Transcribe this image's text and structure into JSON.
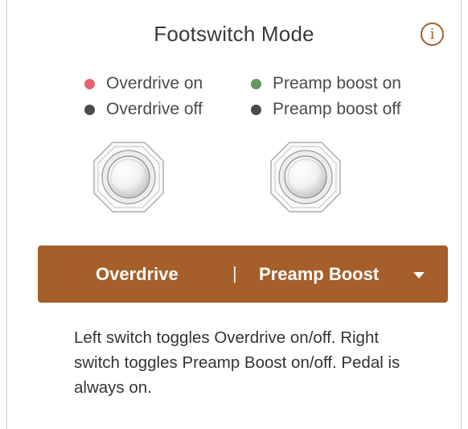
{
  "title": "Footswitch Mode",
  "info_icon_glyph": "i",
  "legend": {
    "left": [
      {
        "label": "Overdrive on",
        "color": "#e8636b"
      },
      {
        "label": "Overdrive off",
        "color": "#4b4b4b"
      }
    ],
    "right": [
      {
        "label": "Preamp boost on",
        "color": "#5f9a5a"
      },
      {
        "label": "Preamp boost off",
        "color": "#4b4b4b"
      }
    ]
  },
  "mode_selector": {
    "left_label": "Overdrive",
    "separator": "|",
    "right_label": "Preamp Boost",
    "icon": "caret-down-icon",
    "background": "#a65f2a"
  },
  "description": "Left switch toggles Overdrive on/off. Right switch toggles Preamp Boost on/off. Pedal is always on."
}
